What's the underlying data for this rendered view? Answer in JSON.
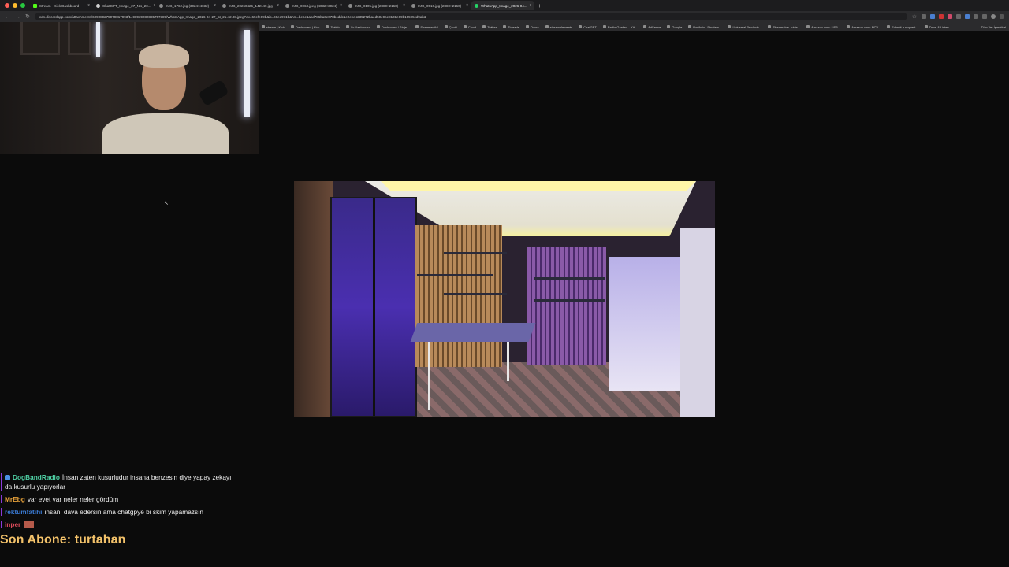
{
  "browser": {
    "tabs": [
      {
        "title": "Stream - Kick Dashboard",
        "icon": "kick-icon",
        "active": false
      },
      {
        "title": "ChatGPT_Image_27_Nis_20...",
        "icon": "chatgpt-icon",
        "active": false
      },
      {
        "title": "IMG_1762.jpg (3024×4032)",
        "icon": "image-icon",
        "active": false
      },
      {
        "title": "IMG_20260426_142149.jpg",
        "icon": "image-icon",
        "active": false
      },
      {
        "title": "IMG_0063.jpeg (4032×3024)",
        "icon": "image-icon",
        "active": false
      },
      {
        "title": "IMG_0105.jpg (2880×2160)",
        "icon": "image-icon",
        "active": false
      },
      {
        "title": "IMG_0510.jpg (2880×2160)",
        "icon": "image-icon",
        "active": false
      },
      {
        "title": "WhatsApp_Image_2026-04...",
        "icon": "whatsapp-icon",
        "active": true
      }
    ],
    "new_tab_label": "+",
    "url": "cdn.discordapp.com/attachments/609089275079817993/1498939282885757389/WhatsApp_Image_2026-04-27_at_21.42.08.jpeg?ex=69efe89b&is=69ee971b&hm=bebe1acd786ba6e078bcddc1e2ece6235272baed50e9be8131e69b16595cd9ab&",
    "bookmarks": [
      "stream | Kick",
      "Dashboard | Kick",
      "Twitch",
      "Yo Dashboard",
      "Dashboard / Stoje...",
      "Streamer Ad",
      "Çeviri",
      "Cloud",
      "Twitter",
      "Threads",
      "Ozura",
      "streamelements",
      "ChatGPT",
      "Radio Garden – Kit...",
      "AdSense",
      "Google",
      "Portfolio | Shutters...",
      "Universal Products...",
      "Streamable - vide...",
      "Amazon.com: USB...",
      "Amazon.com: NCV...",
      "Submit a request...",
      "Drive & Listen"
    ],
    "all_bookmarks_label": "Tüm Yer İşaretleri"
  },
  "chat": {
    "messages": [
      {
        "user": "DogBandRadio",
        "color": "#4fd1a5",
        "text": "İnsan zaten kusurludur insana benzesin diye yapay zekayı da kusurlu yapıyorlar",
        "badge": true
      },
      {
        "user": "MrEbg",
        "color": "#e8a23a",
        "text": "var evet var neler neler gördüm",
        "badge": false
      },
      {
        "user": "rektumfatihi",
        "color": "#3a7bd5",
        "text": "insanı dava edersin ama chatgpye bi skim yapamazsın",
        "badge": false
      },
      {
        "user": "inper",
        "color": "#d94a5a",
        "text": "",
        "badge": false,
        "emote": true
      }
    ]
  },
  "overlay": {
    "last_sub": "Son Abone: turtahan"
  }
}
